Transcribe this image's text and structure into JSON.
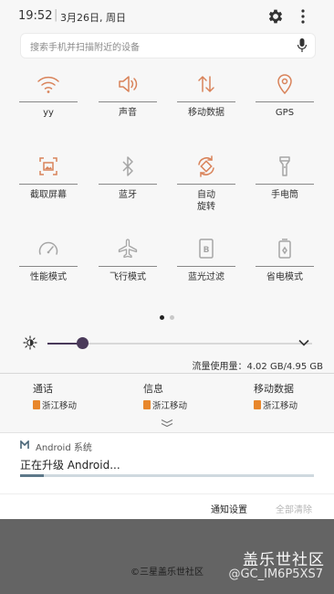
{
  "status": {
    "time": "19:52",
    "separator": "|",
    "date": "3月26日, 周日"
  },
  "search": {
    "placeholder": "搜索手机并扫描附近的设备"
  },
  "tiles": [
    {
      "label": "yy",
      "icon": "wifi-icon",
      "active": true
    },
    {
      "label": "声音",
      "icon": "sound-icon",
      "active": true
    },
    {
      "label": "移动数据",
      "icon": "mobile-data-icon",
      "active": true
    },
    {
      "label": "GPS",
      "icon": "gps-icon",
      "active": true
    },
    {
      "label": "截取屏幕",
      "icon": "screenshot-icon",
      "active": true
    },
    {
      "label": "蓝牙",
      "icon": "bluetooth-icon",
      "active": false
    },
    {
      "label": "自动\n旋转",
      "icon": "auto-rotate-icon",
      "active": true
    },
    {
      "label": "手电筒",
      "icon": "flashlight-icon",
      "active": false
    },
    {
      "label": "性能模式",
      "icon": "performance-icon",
      "active": false
    },
    {
      "label": "飞行模式",
      "icon": "airplane-icon",
      "active": false
    },
    {
      "label": "蓝光过滤",
      "icon": "blue-light-filter-icon",
      "active": false
    },
    {
      "label": "省电模式",
      "icon": "power-saving-icon",
      "active": false
    }
  ],
  "brightness": {
    "level": 0.13
  },
  "usage": {
    "label": "流量使用量：",
    "value": "4.02 GB/4.95 GB"
  },
  "sims": [
    {
      "title": "通话",
      "carrier": "浙江移动"
    },
    {
      "title": "信息",
      "carrier": "浙江移动"
    },
    {
      "title": "移动数据",
      "carrier": "浙江移动"
    }
  ],
  "notification": {
    "app": "Android 系统",
    "title": "正在升级 Android...",
    "progress": 0.08
  },
  "actions": {
    "settings": "通知设置",
    "clear_all": "全部清除"
  },
  "footer": {
    "copyright": "©三星盖乐世社区",
    "watermark_title": "盖乐世社区",
    "watermark_id": "@GC_IM6P5XS7"
  },
  "colors": {
    "accent": "#d9835a",
    "inactive": "#a6a6a6",
    "slider": "#4a3a5a"
  }
}
